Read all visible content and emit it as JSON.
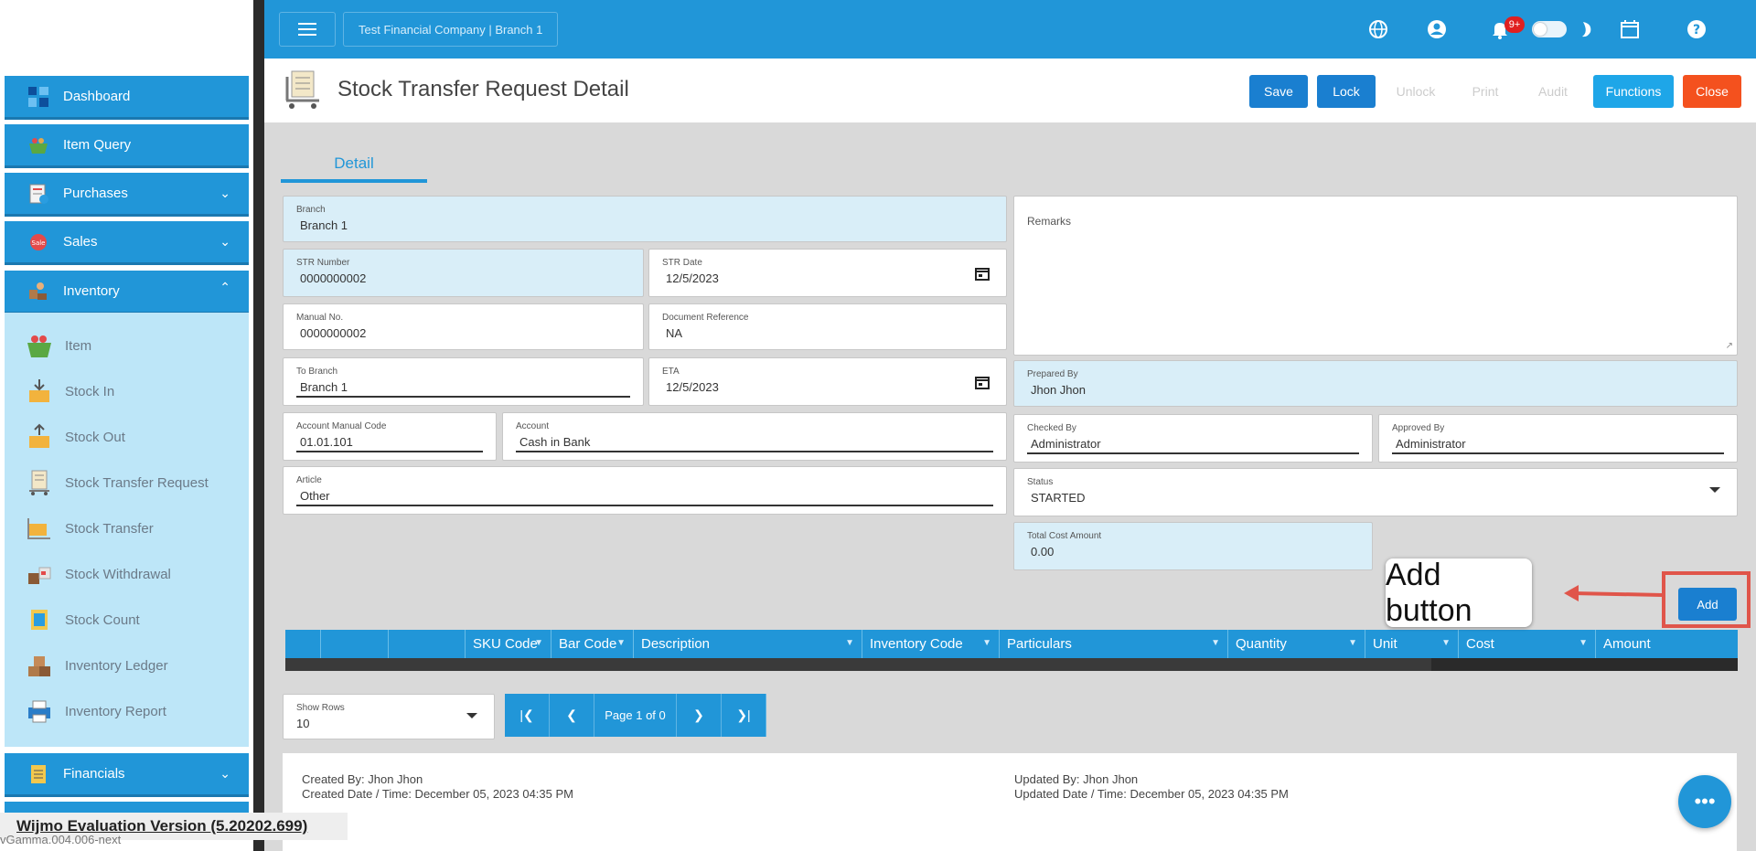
{
  "sidebar": {
    "items": [
      {
        "label": "Dashboard",
        "icon": "dashboard-icon"
      },
      {
        "label": "Item Query",
        "icon": "basket-icon"
      },
      {
        "label": "Purchases",
        "icon": "purchases-icon"
      },
      {
        "label": "Sales",
        "icon": "sale-tag-icon"
      },
      {
        "label": "Inventory",
        "icon": "inventory-icon"
      },
      {
        "label": "Financials",
        "icon": "financials-icon"
      }
    ],
    "inventory_sub": [
      {
        "label": "Item",
        "icon": "basket-icon"
      },
      {
        "label": "Stock In",
        "icon": "box-in-icon"
      },
      {
        "label": "Stock Out",
        "icon": "box-out-icon"
      },
      {
        "label": "Stock Transfer Request",
        "icon": "cart-list-icon"
      },
      {
        "label": "Stock Transfer",
        "icon": "truck-icon"
      },
      {
        "label": "Stock Withdrawal",
        "icon": "boxes-icon"
      },
      {
        "label": "Stock Count",
        "icon": "clipboard-icon"
      },
      {
        "label": "Inventory Ledger",
        "icon": "boxes-stack-icon"
      },
      {
        "label": "Inventory Report",
        "icon": "printer-icon"
      }
    ]
  },
  "topbar": {
    "company": "Test Financial Company | Branch 1",
    "badge": "9+"
  },
  "header": {
    "title": "Stock Transfer Request Detail",
    "buttons": {
      "save": "Save",
      "lock": "Lock",
      "unlock": "Unlock",
      "print": "Print",
      "audit": "Audit",
      "functions": "Functions",
      "close": "Close"
    }
  },
  "tabs": {
    "detail": "Detail"
  },
  "form": {
    "branch": {
      "label": "Branch",
      "value": "Branch 1"
    },
    "str_number": {
      "label": "STR Number",
      "value": "0000000002"
    },
    "str_date": {
      "label": "STR Date",
      "value": "12/5/2023"
    },
    "manual_no": {
      "label": "Manual No.",
      "value": "0000000002"
    },
    "document_reference": {
      "label": "Document Reference",
      "value": "NA"
    },
    "to_branch": {
      "label": "To Branch",
      "value": "Branch 1"
    },
    "eta": {
      "label": "ETA",
      "value": "12/5/2023"
    },
    "account_manual_code": {
      "label": "Account Manual Code",
      "value": "01.01.101"
    },
    "account": {
      "label": "Account",
      "value": "Cash in Bank"
    },
    "article": {
      "label": "Article",
      "value": "Other"
    },
    "remarks": {
      "label": "Remarks",
      "value": ""
    },
    "prepared_by": {
      "label": "Prepared By",
      "value": "Jhon Jhon"
    },
    "checked_by": {
      "label": "Checked By",
      "value": "Administrator"
    },
    "approved_by": {
      "label": "Approved By",
      "value": "Administrator"
    },
    "status": {
      "label": "Status",
      "value": "STARTED"
    },
    "total_cost": {
      "label": "Total Cost Amount",
      "value": "0.00"
    }
  },
  "add_button": "Add",
  "annotation": "Add button",
  "grid": {
    "columns": [
      "",
      "",
      "SKU Code",
      "Bar Code",
      "Description",
      "Inventory Code",
      "Particulars",
      "Quantity",
      "Unit",
      "Cost",
      "Amount"
    ]
  },
  "pager": {
    "show_rows_label": "Show Rows",
    "show_rows_value": "10",
    "page_text": "Page 1 of 0"
  },
  "audit": {
    "created_by": "Created By: Jhon Jhon",
    "created_date": "Created Date / Time: December 05, 2023 04:35 PM",
    "updated_by": "Updated By: Jhon Jhon",
    "updated_date": "Updated Date / Time: December 05, 2023 04:35 PM"
  },
  "footer": {
    "wijmo": "Wijmo Evaluation Version (5.20202.699)",
    "version": "vGamma.004.006-next"
  },
  "colors": {
    "primary": "#2196d8",
    "lock": "#1a7fd0",
    "close": "#f4511e",
    "panel": "#bde6f8"
  }
}
